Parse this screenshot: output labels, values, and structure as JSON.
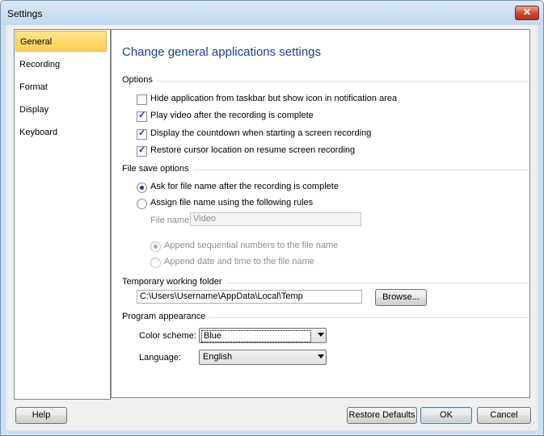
{
  "window": {
    "title": "Settings",
    "close_symbol": "✕"
  },
  "nav": {
    "items": [
      {
        "label": "General",
        "selected": true
      },
      {
        "label": "Recording",
        "selected": false
      },
      {
        "label": "Format",
        "selected": false
      },
      {
        "label": "Display",
        "selected": false
      },
      {
        "label": "Keyboard",
        "selected": false
      }
    ]
  },
  "main": {
    "heading": "Change general applications settings",
    "options": {
      "label": "Options",
      "items": [
        {
          "label": "Hide application from taskbar but show icon in notification area",
          "checked": false
        },
        {
          "label": "Play video after the recording is complete",
          "checked": true
        },
        {
          "label": "Display the countdown when starting a screen recording",
          "checked": true
        },
        {
          "label": "Restore cursor location on resume screen recording",
          "checked": true
        }
      ]
    },
    "file_save": {
      "label": "File save options",
      "ask_label": "Ask for file name after the recording is complete",
      "assign_label": "Assign file name using the following rules",
      "file_name_label": "File name:",
      "file_name_value": "Video",
      "append_seq_label": "Append sequential numbers to the file name",
      "append_date_label": "Append date and time to the file name"
    },
    "temp_folder": {
      "label": "Temporary working folder",
      "path": "C:\\Users\\Username\\AppData\\Local\\Temp",
      "browse_label": "Browse..."
    },
    "appearance": {
      "label": "Program appearance",
      "color_scheme_label": "Color scheme:",
      "color_scheme_value": "Blue",
      "language_label": "Language:",
      "language_value": "English"
    }
  },
  "footer": {
    "help_label": "Help",
    "restore_label": "Restore Defaults",
    "ok_label": "OK",
    "cancel_label": "Cancel"
  },
  "colors": {
    "accent": "#1e3f89",
    "selection": "#fbcf53",
    "window_frame": "#cfe0f2"
  }
}
